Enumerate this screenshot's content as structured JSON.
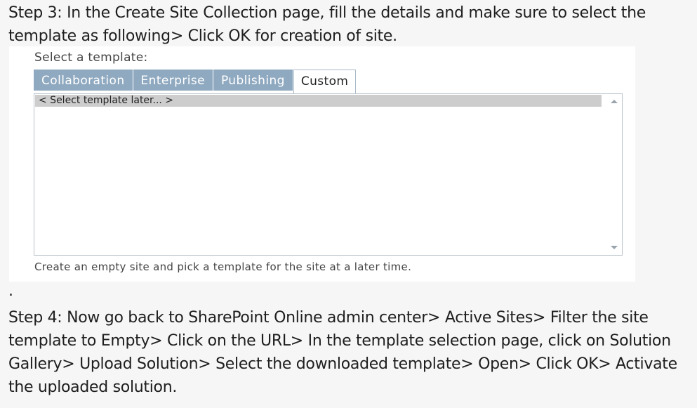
{
  "step3": {
    "text": "Step 3: In the Create Site Collection page, fill the details and make sure to select the template as following> Click OK for creation of site."
  },
  "screenshot": {
    "select_label": "Select a template:",
    "tabs": [
      {
        "label": "Collaboration",
        "active": false
      },
      {
        "label": "Enterprise",
        "active": false
      },
      {
        "label": "Publishing",
        "active": false
      },
      {
        "label": "Custom",
        "active": true
      }
    ],
    "list_items": [
      "< Select template later... >"
    ],
    "description": "Create an empty site and pick a template for the site at a later time."
  },
  "bullet": ".",
  "step4": {
    "text": "Step 4: Now go back to SharePoint Online admin center> Active Sites> Filter the site template to Empty> Click on the URL> In the template selection page, click on Solution Gallery> Upload Solution> Select the downloaded template> Open> Click OK> Activate the uploaded solution."
  }
}
